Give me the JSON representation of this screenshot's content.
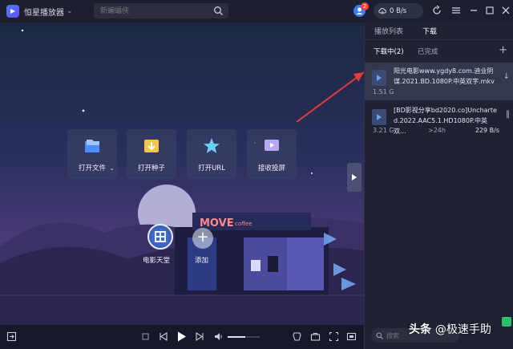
{
  "titlebar": {
    "app_title": "恒星播放器",
    "search_placeholder": "新蝙蝠侠",
    "message_badge": "2",
    "speed": "0 B/s"
  },
  "stage": {
    "actions": [
      {
        "label": "打开文件"
      },
      {
        "label": "打开种子"
      },
      {
        "label": "打开URL"
      },
      {
        "label": "接收投屏"
      }
    ],
    "shortcuts": {
      "film_label": "电影天堂",
      "add_label": "添加"
    },
    "scene": {
      "sign_text": "MOVE",
      "sign_sub": "coffee"
    }
  },
  "controls": {
    "volume": 0.55
  },
  "panel": {
    "tabs": [
      "播放列表",
      "下载"
    ],
    "active_tab": "下载",
    "sub_tabs": [
      "下载中(2)",
      "已完成"
    ],
    "downloads": [
      {
        "name": "阳光电影www.ygdy8.com.迪业阴谋.2021.BD.1080P.中英双字.mkv",
        "size": "1.51 G",
        "eta": "",
        "speed": ""
      },
      {
        "name": "[BD影视分享bd2020.co]Uncharted.2022.AAC5.1.HD1080P.中英双...",
        "size": "3.21 G",
        "eta": ">24h",
        "speed": "229 B/s"
      }
    ],
    "search_placeholder": "搜索"
  },
  "watermark": {
    "prefix": "头条",
    "handle": "@极速手助"
  },
  "colors": {
    "accent": "#4a7bff",
    "badge": "#ff3b3b",
    "arrow": "#e23b3b"
  }
}
